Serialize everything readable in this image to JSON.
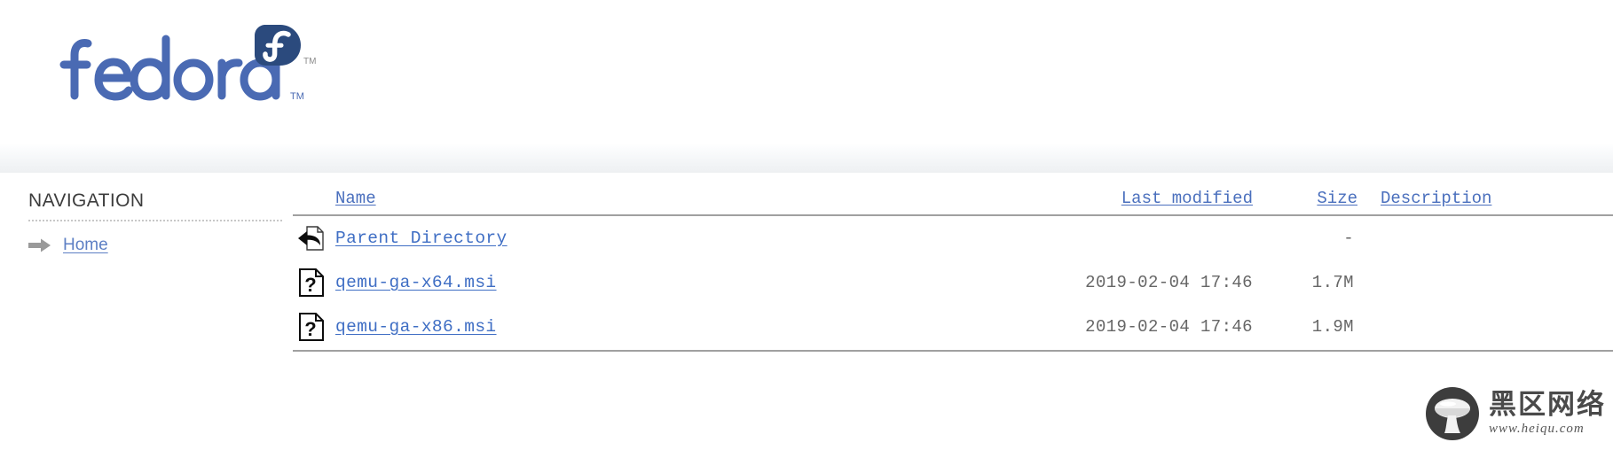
{
  "site": {
    "brand_name": "fedora",
    "brand_trademark": "TM",
    "brand_color": "#4a6ab3",
    "brand_logo_mark_color": "#2b4a7d",
    "logo_icon": "fedora-f-logo-icon"
  },
  "sidebar": {
    "heading": "NAVIGATION",
    "items": [
      {
        "label": "Home",
        "icon": "arrow-right-icon"
      }
    ]
  },
  "listing": {
    "columns": [
      {
        "key": "name",
        "label": "Name"
      },
      {
        "key": "last_modified",
        "label": "Last modified"
      },
      {
        "key": "size",
        "label": "Size"
      },
      {
        "key": "description",
        "label": "Description"
      }
    ],
    "rows": [
      {
        "icon": "parent-directory-icon",
        "name": "Parent Directory",
        "last_modified": "",
        "size": "-",
        "description": ""
      },
      {
        "icon": "unknown-file-icon",
        "name": "qemu-ga-x64.msi",
        "last_modified": "2019-02-04 17:46",
        "size": "1.7M",
        "description": ""
      },
      {
        "icon": "unknown-file-icon",
        "name": "qemu-ga-x86.msi",
        "last_modified": "2019-02-04 17:46",
        "size": "1.9M",
        "description": ""
      }
    ],
    "link_color": "#3f6ec4",
    "text_color": "#666666"
  },
  "watermark": {
    "logo_icon": "mushroom-logo-icon",
    "name_cn": "黑区网络",
    "url": "www.heiqu.com"
  }
}
